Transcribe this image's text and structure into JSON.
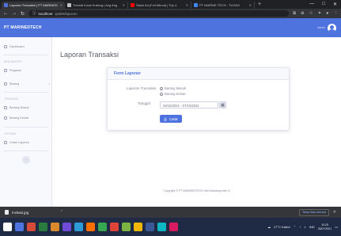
{
  "browser": {
    "tabs": [
      {
        "label": "Laporan Transaksi | PT MARINED",
        "active": true,
        "color": "#4e73df"
      },
      {
        "label": "Tutorial Koda Kuliang | Ang Ang",
        "active": false,
        "color": "#bdc1c6"
      },
      {
        "label": "Stack Ad (Full Album) | Top 4",
        "active": false,
        "color": "#ff0000"
      },
      {
        "label": "PT MARINE TECH - TUGAS",
        "active": false,
        "color": "#4285f4"
      }
    ],
    "new_tab": "+",
    "url_host": "localhost",
    "url_path": "/pallet/laporan",
    "window_controls": [
      "—",
      "□",
      "✕"
    ]
  },
  "app": {
    "brand": "PT MARINEDTECH",
    "user_name": "Admin"
  },
  "sidebar": {
    "items": [
      {
        "label": "Dashboard",
        "icon": "gauge-icon"
      },
      {
        "label": "Pegawai",
        "icon": "users-icon"
      },
      {
        "label": "Barang",
        "icon": "box-icon",
        "has_chevron": true
      },
      {
        "label": "Barang Masuk",
        "icon": "inbox-icon"
      },
      {
        "label": "Barang Keluar",
        "icon": "outbox-icon"
      },
      {
        "label": "Cetak Laporan",
        "icon": "print-icon"
      }
    ],
    "headers": [
      "DATA MASTER",
      "TRANSAKSI",
      "LAPORAN"
    ],
    "toggle": "‹"
  },
  "page": {
    "title": "Laporan Transaksi",
    "card_title": "Form Laporan",
    "transaksi_label": "Laporan Transaksi",
    "radio_options": [
      "Barang Masuk",
      "Barang Keluar"
    ],
    "tanggal_label": "Tanggal",
    "date_value": "26/10/2021 - 07/10/2021",
    "print_label": "Cetak",
    "footer": "Copyright © PT MARINEDTECH oleh Nandang oleh ill"
  },
  "download_bar": {
    "file_name": "Invitasi.jpg",
    "show_all": "Tamp lkan semua",
    "close": "✕"
  },
  "taskbar": {
    "weather": "27°C Kabut",
    "lang": "IND",
    "time": "10.25",
    "date": "26/07/2021",
    "apps": [
      "#3c7be0",
      "#d64a3a",
      "#2a7b3f",
      "#d88a2d",
      "#6f4bd8",
      "#2d9bd8",
      "#ff6f00",
      "#36a852",
      "#e0433a",
      "#7cb342",
      "#f2b705",
      "#3b5998",
      "#0db7c4",
      "#d81b60"
    ]
  }
}
